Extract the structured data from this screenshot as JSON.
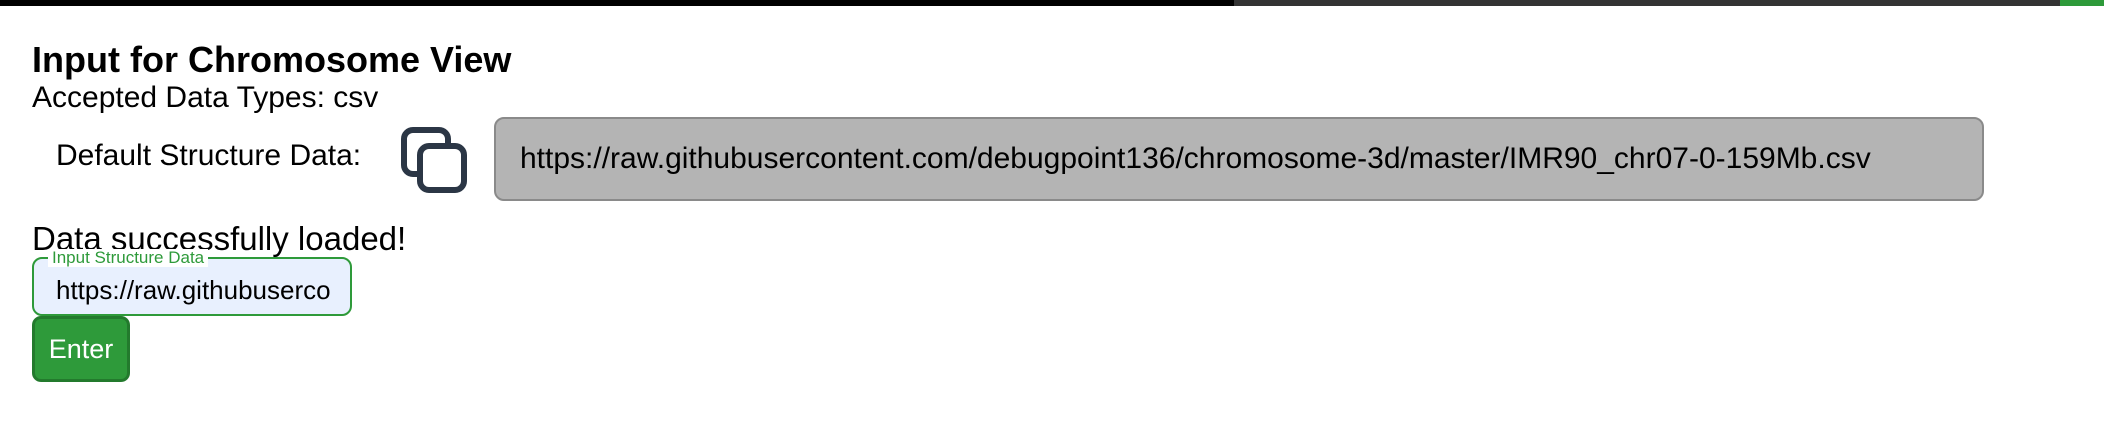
{
  "topbar": {
    "colors": [
      "#000000",
      "#333333",
      "#2e9a3a"
    ]
  },
  "section": {
    "title": "Input for Chromosome View",
    "accepted_types": "Accepted Data Types: csv"
  },
  "default_structure": {
    "label": "Default Structure Data:",
    "copy_icon": "copy-icon",
    "url": "https://raw.githubusercontent.com/debugpoint136/chromosome-3d/master/IMR90_chr07-0-159Mb.csv"
  },
  "status": {
    "message": "Data successfully loaded!"
  },
  "input": {
    "legend": "Input Structure Data",
    "value": "https://raw.githubuserco",
    "accent_color": "#2e9a3a"
  },
  "enter_button": {
    "label": "Enter"
  }
}
